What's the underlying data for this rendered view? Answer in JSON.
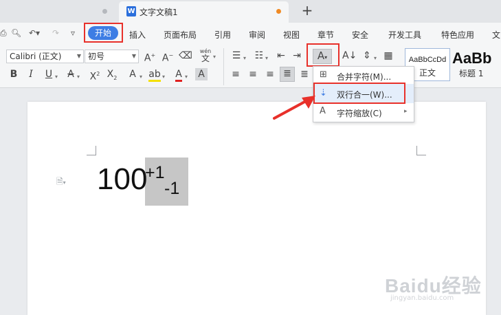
{
  "tabs": {
    "active_title": "文字文稿1",
    "doc_icon_letter": "W",
    "new_tab_symbol": "+"
  },
  "menu": {
    "start": "开始",
    "items": [
      "插入",
      "页面布局",
      "引用",
      "审阅",
      "视图",
      "章节",
      "安全",
      "开发工具",
      "特色应用",
      "文"
    ]
  },
  "ribbon": {
    "font_name": "Calibri (正文)",
    "font_size": "初号",
    "style_normal_preview": "AaBbCcDd",
    "style_normal_label": "正文",
    "style_h1_preview": "AaBb",
    "style_h1_label": "标题 1",
    "pinyin_label": "wén"
  },
  "dropdown": {
    "items": [
      "合并字符(M)...",
      "双行合一(W)...",
      "字符缩放(C)"
    ]
  },
  "document": {
    "base": "100",
    "sup": "+1",
    "sub": "-1"
  },
  "watermark": {
    "brand": "Baidu经验",
    "url": "jingyan.baidu.com"
  },
  "colors": {
    "accent": "#3d7de4",
    "highlight_red": "#e8302a",
    "active_tab_dot": "#f08a24"
  }
}
